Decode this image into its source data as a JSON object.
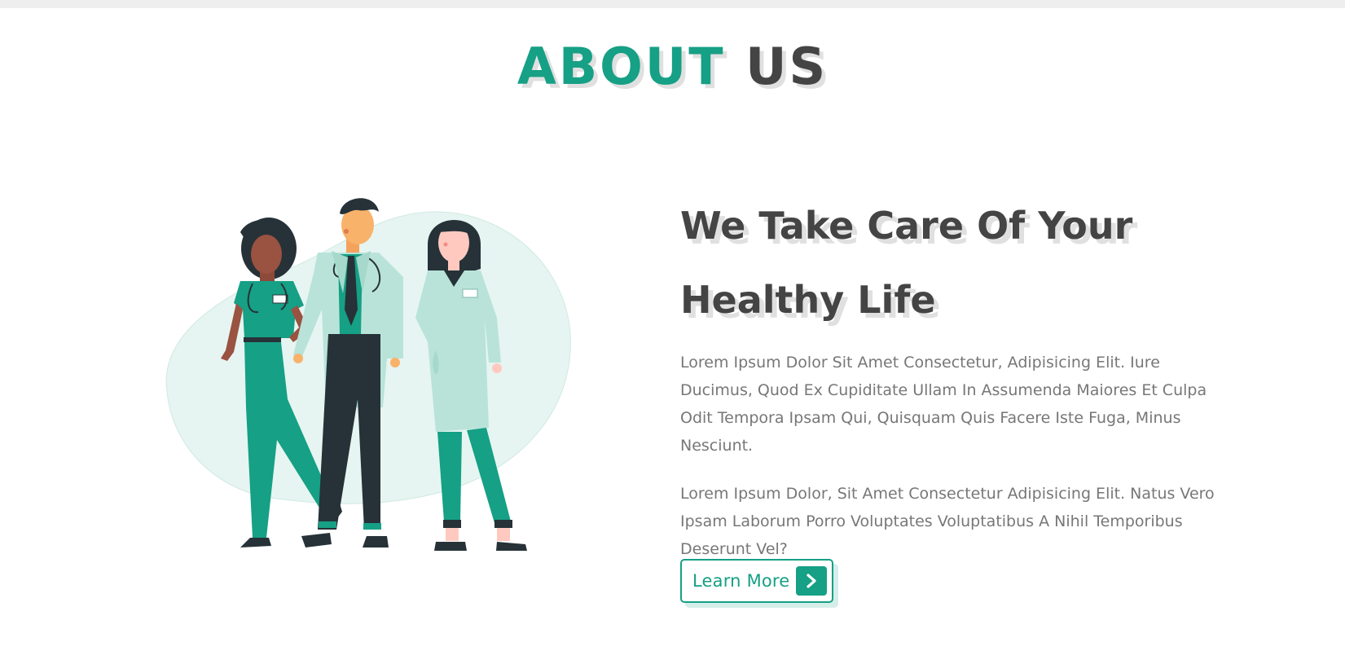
{
  "section": {
    "heading_accent": "ABOUT",
    "heading_rest": "US"
  },
  "content": {
    "title": "We Take Care Of Your Healthy Life",
    "paragraph_1": "Lorem Ipsum Dolor Sit Amet Consectetur, Adipisicing Elit. Iure Ducimus, Quod Ex Cupiditate Ullam In Assumenda Maiores Et Culpa Odit Tempora Ipsam Qui, Quisquam Quis Facere Iste Fuga, Minus Nesciunt.",
    "paragraph_2": "Lorem Ipsum Dolor, Sit Amet Consectetur Adipisicing Elit. Natus Vero Ipsam Laborum Porro Voluptates Voluptatibus A Nihil Temporibus Deserunt Vel?",
    "button_label": "Learn More",
    "button_icon": "chevron-right-icon"
  },
  "colors": {
    "accent": "#16a085",
    "dark_text": "#444444",
    "body_text": "#777777",
    "blob": "#e6f5f1",
    "coat": "#b9e3d9"
  }
}
